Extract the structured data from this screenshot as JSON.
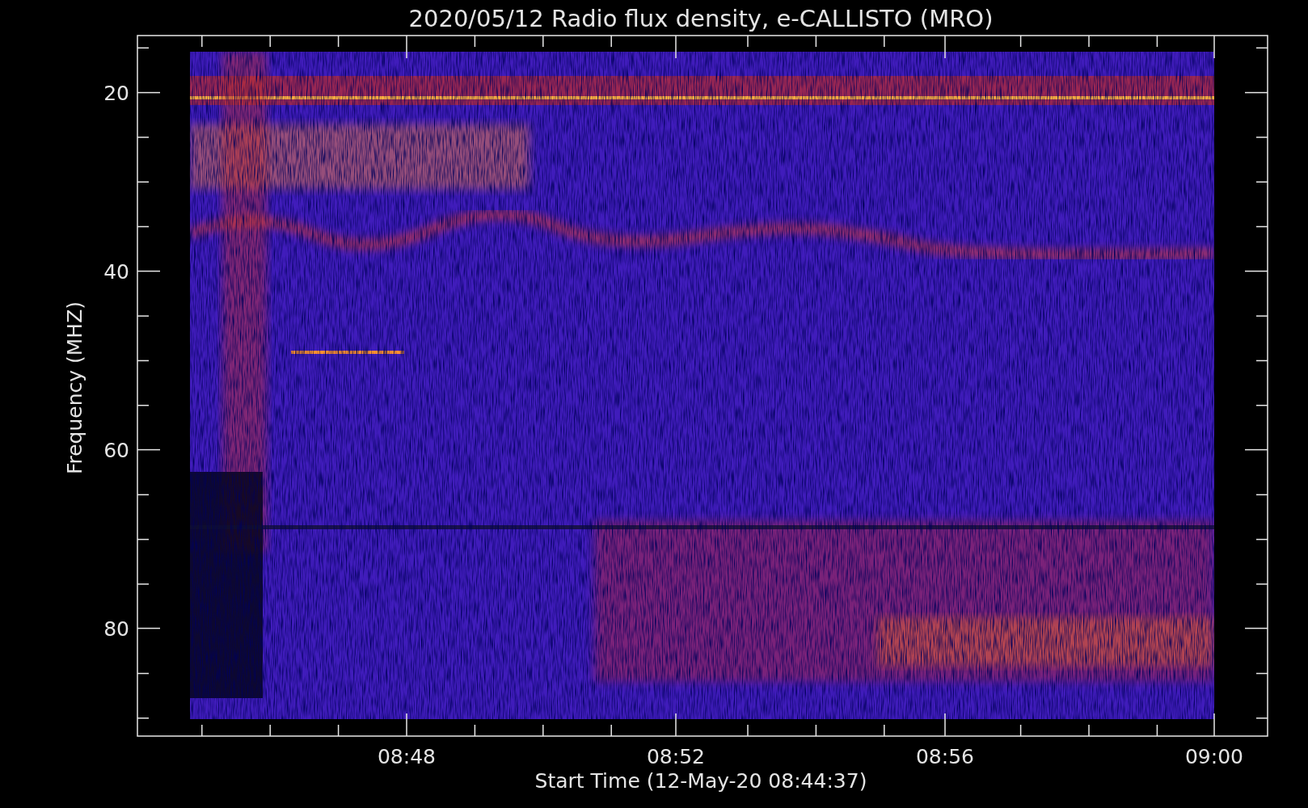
{
  "plot": {
    "title": "2020/05/12  Radio flux density, e-CALLISTO (MRO)",
    "ylabel": "Frequency (MHZ)",
    "xlabel": "Start Time (12-May-20 08:44:37)",
    "y_tick_labels": [
      "20",
      "40",
      "60",
      "80"
    ],
    "x_tick_labels": [
      "08:48",
      "08:52",
      "08:56",
      "09:00"
    ]
  }
}
